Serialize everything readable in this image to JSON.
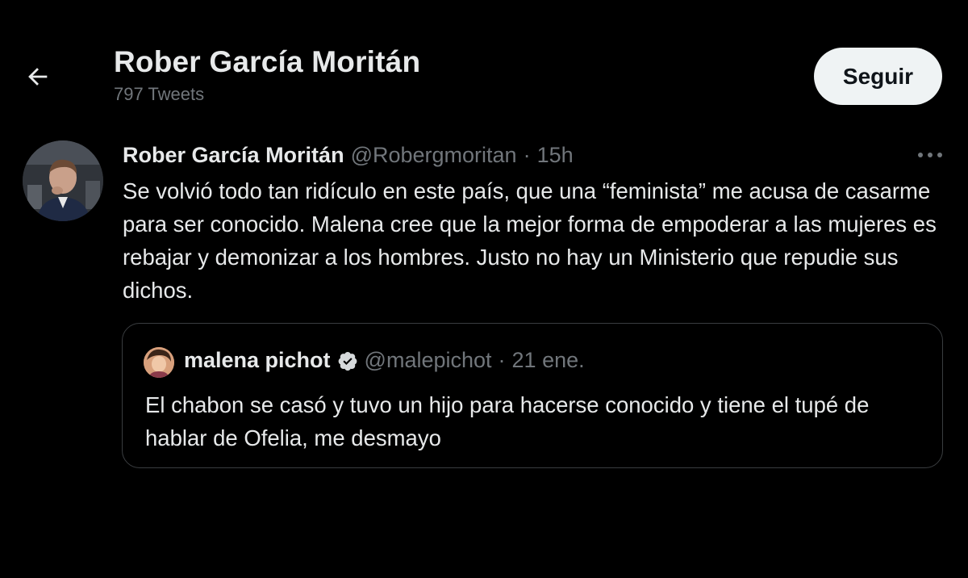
{
  "header": {
    "back_icon": "arrow-left-icon",
    "profile_name": "Rober García Moritán",
    "tweet_count": "797 Tweets",
    "follow_label": "Seguir"
  },
  "tweet": {
    "author_name": "Rober García Moritán",
    "handle": "@Robergmoritan",
    "separator": "·",
    "time": "15h",
    "more_icon": "ellipsis-icon",
    "text": "Se volvió todo tan ridículo en este país, que una “feminista” me acusa de casarme para ser conocido. Malena cree que la mejor forma de empoderar a las mujeres es rebajar y demonizar a los hombres. Justo no hay un Ministerio que repudie sus dichos.",
    "quote": {
      "author_name": "malena pichot",
      "verified_icon": "verified-badge-icon",
      "handle": "@malepichot",
      "separator": "·",
      "date": "21 ene.",
      "text": "El chabon se casó y tuvo un hijo para hacerse conocido y tiene el tupé de hablar de Ofelia, me desmayo"
    }
  },
  "colors": {
    "background": "#000000",
    "primary_text": "#e7e9ea",
    "secondary_text": "#71767b",
    "follow_button_bg": "#eff3f4",
    "border": "#3a3d40"
  }
}
